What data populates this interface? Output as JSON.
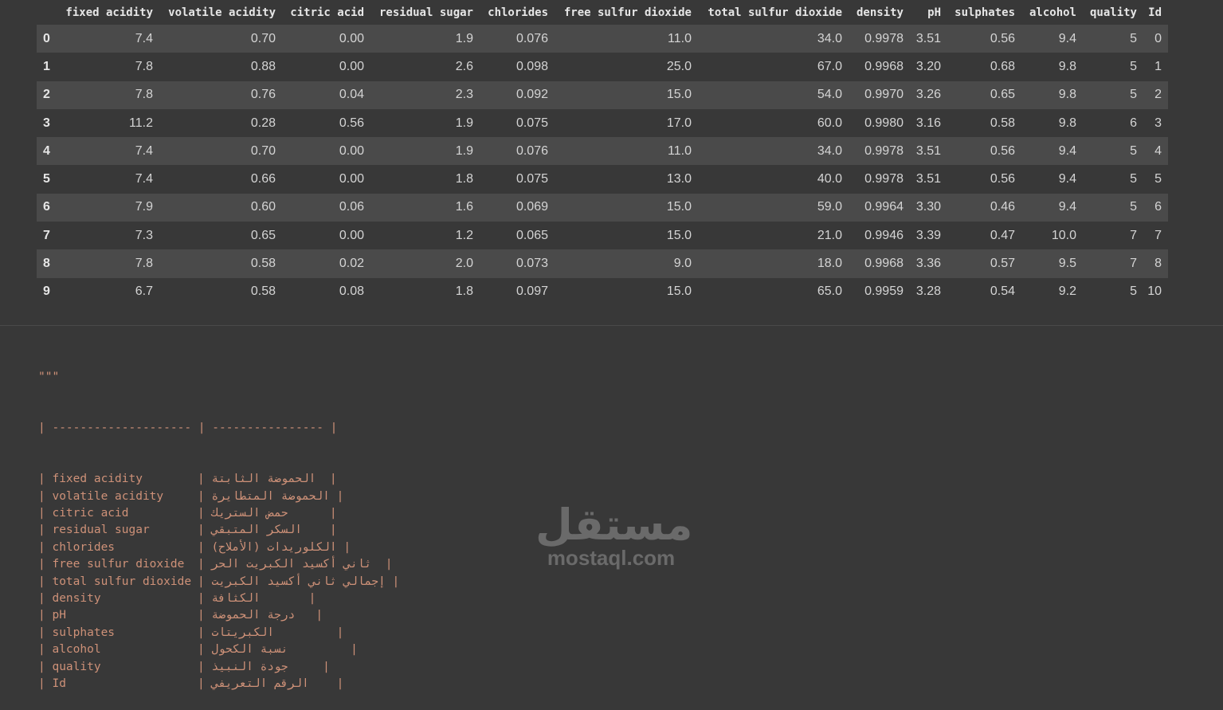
{
  "table": {
    "columns": [
      "",
      "fixed acidity",
      "volatile acidity",
      "citric acid",
      "residual sugar",
      "chlorides",
      "free sulfur dioxide",
      "total sulfur dioxide",
      "density",
      "pH",
      "sulphates",
      "alcohol",
      "quality",
      "Id"
    ],
    "rows": [
      [
        "0",
        "7.4",
        "0.70",
        "0.00",
        "1.9",
        "0.076",
        "11.0",
        "34.0",
        "0.9978",
        "3.51",
        "0.56",
        "9.4",
        "5",
        "0"
      ],
      [
        "1",
        "7.8",
        "0.88",
        "0.00",
        "2.6",
        "0.098",
        "25.0",
        "67.0",
        "0.9968",
        "3.20",
        "0.68",
        "9.8",
        "5",
        "1"
      ],
      [
        "2",
        "7.8",
        "0.76",
        "0.04",
        "2.3",
        "0.092",
        "15.0",
        "54.0",
        "0.9970",
        "3.26",
        "0.65",
        "9.8",
        "5",
        "2"
      ],
      [
        "3",
        "11.2",
        "0.28",
        "0.56",
        "1.9",
        "0.075",
        "17.0",
        "60.0",
        "0.9980",
        "3.16",
        "0.58",
        "9.8",
        "6",
        "3"
      ],
      [
        "4",
        "7.4",
        "0.70",
        "0.00",
        "1.9",
        "0.076",
        "11.0",
        "34.0",
        "0.9978",
        "3.51",
        "0.56",
        "9.4",
        "5",
        "4"
      ],
      [
        "5",
        "7.4",
        "0.66",
        "0.00",
        "1.8",
        "0.075",
        "13.0",
        "40.0",
        "0.9978",
        "3.51",
        "0.56",
        "9.4",
        "5",
        "5"
      ],
      [
        "6",
        "7.9",
        "0.60",
        "0.06",
        "1.6",
        "0.069",
        "15.0",
        "59.0",
        "0.9964",
        "3.30",
        "0.46",
        "9.4",
        "5",
        "6"
      ],
      [
        "7",
        "7.3",
        "0.65",
        "0.00",
        "1.2",
        "0.065",
        "15.0",
        "21.0",
        "0.9946",
        "3.39",
        "0.47",
        "10.0",
        "7",
        "7"
      ],
      [
        "8",
        "7.8",
        "0.58",
        "0.02",
        "2.0",
        "0.073",
        "9.0",
        "18.0",
        "0.9968",
        "3.36",
        "0.57",
        "9.5",
        "7",
        "8"
      ],
      [
        "9",
        "6.7",
        "0.58",
        "0.08",
        "1.8",
        "0.097",
        "15.0",
        "65.0",
        "0.9959",
        "3.28",
        "0.54",
        "9.2",
        "5",
        "10"
      ]
    ]
  },
  "code_cell": {
    "opening": "\"\"\"",
    "separator": "| -------------------- | ---------------- |",
    "rows": [
      {
        "en": "| fixed acidity",
        "ar": "| الحموضة الثابتة  |"
      },
      {
        "en": "| volatile acidity",
        "ar": "| الحموضة المتطايرة |"
      },
      {
        "en": "| citric acid",
        "ar": "| حمض الستريك      |"
      },
      {
        "en": "| residual sugar",
        "ar": "| السكر المتبقي    |"
      },
      {
        "en": "| chlorides",
        "ar": "| الكلوريدات (الأملاح) |"
      },
      {
        "en": "| free sulfur dioxide",
        "ar": "| ثاني أكسيد الكبريت الحر  |"
      },
      {
        "en": "| total sulfur dioxide",
        "ar": "| إجمالي ثاني أكسيد الكبريت |"
      },
      {
        "en": "| density",
        "ar": "| الكثافة       |"
      },
      {
        "en": "| pH",
        "ar": "| درجة الحموضة   |"
      },
      {
        "en": "| sulphates",
        "ar": "| الكبريتات         |"
      },
      {
        "en": "| alcohol",
        "ar": "| نسبة الكحول         |"
      },
      {
        "en": "| quality",
        "ar": "| جودة النبيذ     |"
      },
      {
        "en": "| Id",
        "ar": "| الرقم التعريفي    |"
      }
    ]
  },
  "watermark": {
    "arabic": "مستقل",
    "latin": "mostaql.com"
  }
}
